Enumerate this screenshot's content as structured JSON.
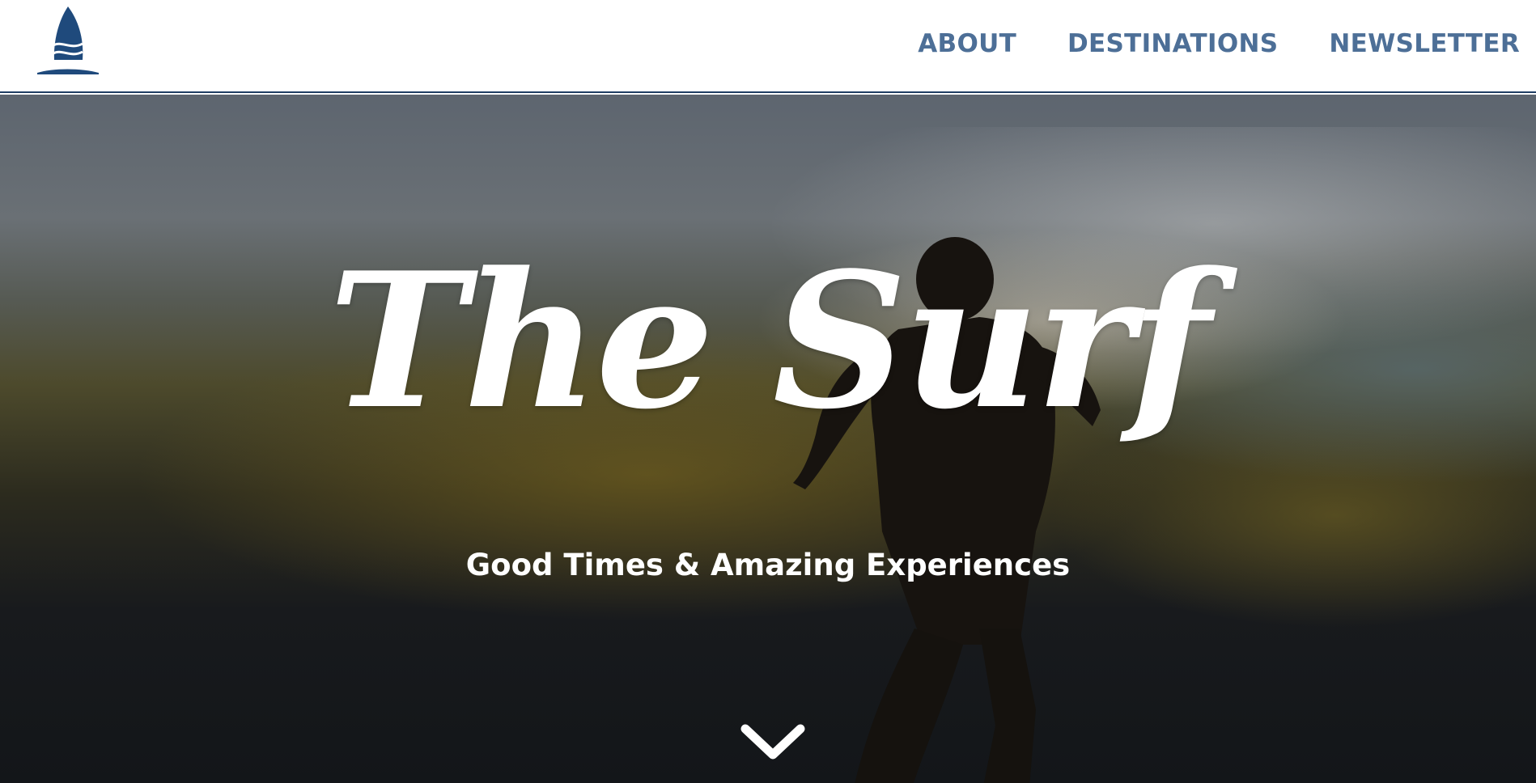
{
  "header": {
    "logo_icon": "sailboat-logo-icon",
    "nav": [
      {
        "label": "ABOUT"
      },
      {
        "label": "DESTINATIONS"
      },
      {
        "label": "NEWSLETTER"
      }
    ]
  },
  "hero": {
    "title": "The Surf",
    "subtitle": "Good Times & Amazing Experiences",
    "scroll_icon": "chevron-down-icon"
  },
  "colors": {
    "nav_text": "#4d6f97",
    "logo": "#1f4a7c",
    "header_border": "#1f3d63",
    "hero_text": "#ffffff"
  }
}
